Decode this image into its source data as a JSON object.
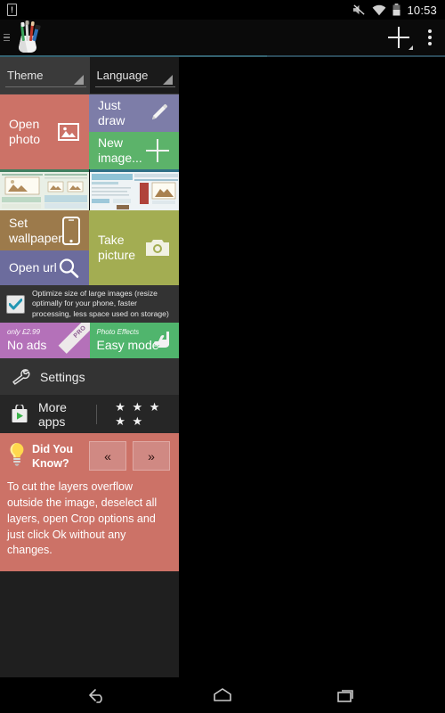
{
  "status_bar": {
    "alert_icon": "alert-badge-icon",
    "alert_glyph": "!",
    "mute_icon": "volume-mute-icon",
    "wifi_icon": "wifi-icon",
    "battery_icon": "battery-icon",
    "clock": "10:53"
  },
  "action_bar": {
    "up_icon": "navigate-up-icon",
    "app_logo": "paint-brushes-logo",
    "add_label": "add-with-dropdown-icon",
    "overflow_label": "overflow-menu-icon"
  },
  "drawer": {
    "spinners": [
      {
        "label": "Theme",
        "caret_icon": "dropdown-caret-icon"
      },
      {
        "label": "Language",
        "caret_icon": "dropdown-caret-icon"
      }
    ],
    "tiles": [
      {
        "label": "Open photo",
        "icon": "image-icon",
        "color": "#cc7267"
      },
      {
        "label": "Just draw",
        "icon": "pencil-icon",
        "color": "#7d7da8"
      },
      {
        "label": "New image...",
        "icon": "plus-icon",
        "color": "#5cb36a"
      },
      {
        "label": "Set wallpaper",
        "icon": "phone-icon",
        "color": "#9c7a4b"
      },
      {
        "label": "Open url",
        "icon": "magnifier-icon",
        "color": "#6c6c9d"
      },
      {
        "label": "Take picture",
        "icon": "camera-icon",
        "color": "#a3ad52"
      }
    ],
    "recent_thumbnails": [
      {
        "name": "recent-image-1"
      },
      {
        "name": "recent-image-2"
      }
    ],
    "optimize": {
      "checked": true,
      "checkbox_icon": "checkmark-icon",
      "text": "Optimize size of large images (resize optimally for your phone, faster processing, less space used on storage)"
    },
    "promos": [
      {
        "price": "only £2.99",
        "title": "No ads",
        "ribbon": "PRO",
        "color": "#b471b9",
        "icon": "pro-ribbon-icon"
      },
      {
        "subtitle": "Photo Effects",
        "title": "Easy mode",
        "color": "#50b56d",
        "icon": "hand-pointer-icon"
      }
    ],
    "settings_row": {
      "label": "Settings",
      "icon": "wrench-icon"
    },
    "more_apps_row": {
      "label": "More apps",
      "icon": "play-store-icon",
      "rating": "★ ★ ★ ★ ★"
    },
    "tip": {
      "icon": "lightbulb-icon",
      "title": "Did You Know?",
      "prev_label": "«",
      "next_label": "»",
      "body": "To cut the layers overflow outside the image, deselect all layers, open Crop options and just click Ok without any changes."
    }
  },
  "nav_bar": {
    "back_icon": "back-icon",
    "home_icon": "home-icon",
    "recents_icon": "recent-apps-icon"
  }
}
